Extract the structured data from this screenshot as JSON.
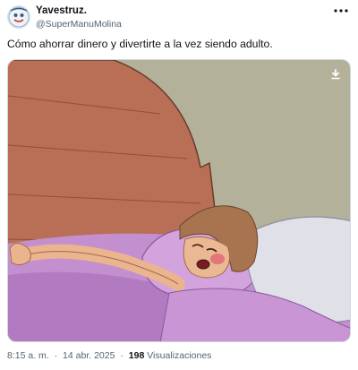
{
  "author": {
    "name": "Yavestruz.",
    "handle": "@SuperManuMolina",
    "avatar_icon": "avatar-image"
  },
  "header": {
    "more_icon": "more-options-icon"
  },
  "tweet": {
    "text": "Cómo ahorrar dinero y divertirte a la vez siendo adulto."
  },
  "media": {
    "description_icon": "meme-image",
    "download_icon": "download-icon"
  },
  "meta": {
    "time": "8:15 a. m.",
    "separator_1": "·",
    "date": "14 abr. 2025",
    "separator_2": "·",
    "views_count": "198",
    "views_label": "Visualizaciones"
  },
  "colors": {
    "text_primary": "#0f1419",
    "text_secondary": "#536471",
    "border": "#cfd9de"
  }
}
